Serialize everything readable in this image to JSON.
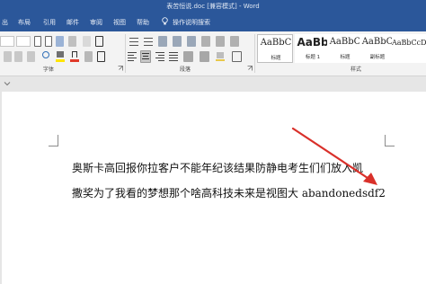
{
  "window": {
    "title": "表苦恒说.doc [兼容模式] - Word"
  },
  "tabs": [
    {
      "label": "出"
    },
    {
      "label": "布局"
    },
    {
      "label": "引用"
    },
    {
      "label": "邮件"
    },
    {
      "label": "审阅"
    },
    {
      "label": "视图"
    },
    {
      "label": "帮助"
    }
  ],
  "tell_me": {
    "label": "操作说明搜索",
    "icon": "lightbulb-icon"
  },
  "ribbon": {
    "groups": {
      "font": "字体",
      "paragraph": "段落",
      "styles": "样式"
    },
    "styles": [
      {
        "sample": "AaBbC",
        "name": "标题"
      },
      {
        "sample": "AaBb",
        "name": "标题 1"
      },
      {
        "sample": "AaBbC",
        "name": "标题"
      },
      {
        "sample": "AaBbC",
        "name": "副标题"
      },
      {
        "sample": "AaBbCcDı",
        "name": ""
      }
    ]
  },
  "document": {
    "lines": [
      "奥斯卡高回报你拉客户不能年纪该结果防静电考生们们放入凯",
      "撒奖为了我看的梦想那个啥高科技未来是视图大 abandonedsdf2"
    ]
  },
  "annotation": {
    "arrow_color": "#d9302a",
    "icon": "red-arrow-icon"
  },
  "colors": {
    "ribbon_blue": "#2b579a",
    "ribbon_body": "#f3f3f3",
    "page": "#ffffff",
    "canvas": "#e6e6e6"
  }
}
